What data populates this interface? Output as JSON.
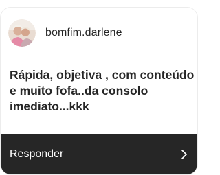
{
  "comment": {
    "username": "bomfim.darlene",
    "text": "Rápida, objetiva , com conteúdo e muito fofa..da consolo imediato...kkk",
    "avatar_icon": "profile-photo"
  },
  "reply": {
    "label": "Responder",
    "icon": "chevron-right-icon"
  },
  "colors": {
    "text": "#262626",
    "reply_bar": "#262626",
    "reply_text": "#ffffff"
  }
}
